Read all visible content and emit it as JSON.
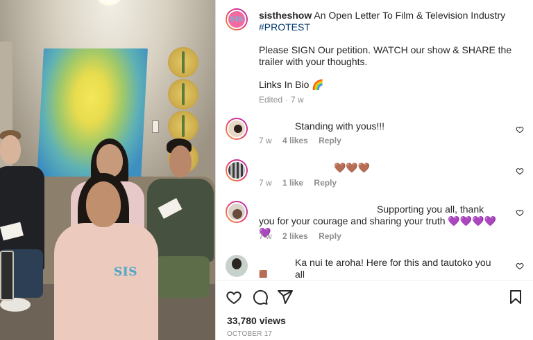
{
  "post": {
    "username": "sistheshow",
    "caption_line1": "An Open Letter To Film & Television Industry",
    "hashtag": "#PROTEST",
    "caption_para2": "Please SIGN Our petition. WATCH our show & SHARE the trailer with your thoughts.",
    "caption_para3": "Links In Bio 🌈",
    "edited": "Edited",
    "age": "7 w",
    "avatar_logo": "SIS"
  },
  "video": {
    "hoodie_text": "SIS"
  },
  "comments": [
    {
      "text": "Standing with yous!!!",
      "age": "7 w",
      "likes": "4 likes",
      "reply": "Reply",
      "avatar": "avatar-commenter-1"
    },
    {
      "text": "🤎🤎🤎",
      "age": "7 w",
      "likes": "1 like",
      "reply": "Reply",
      "avatar": "avatar-commenter-2"
    },
    {
      "text": "Supporting you all, thank you for your courage and sharing your truth 💜💜💜💜💜",
      "age": "7 w",
      "likes": "2 likes",
      "reply": "Reply",
      "avatar": "avatar-commenter-3"
    },
    {
      "text": "Ka nui te aroha! Here for this and tautoko you all",
      "extra": "🟫",
      "avatar": "avatar-commenter-4"
    }
  ],
  "actions": {
    "like_icon": "heart-icon",
    "comment_icon": "comment-icon",
    "share_icon": "send-icon",
    "save_icon": "bookmark-icon"
  },
  "views": "33,780 views",
  "date": "OCTOBER 17",
  "colors": {
    "text": "#262626",
    "muted": "#8e8e8e",
    "hashtag": "#00376b",
    "border": "#dbdbdb",
    "brand_pink": "#f26aa0",
    "brand_blue": "#5ec2e3"
  }
}
